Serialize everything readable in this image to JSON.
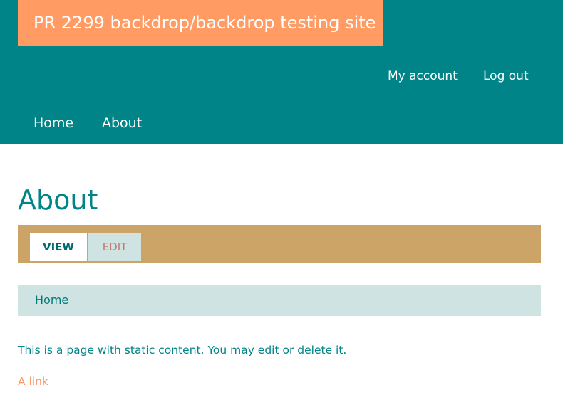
{
  "header": {
    "site_name": "PR 2299 backdrop/backdrop testing site",
    "account_menu": [
      "My account",
      "Log out"
    ],
    "main_menu": [
      "Home",
      "About"
    ]
  },
  "page": {
    "title": "About",
    "tabs": [
      {
        "label": "VIEW",
        "active": true
      },
      {
        "label": "EDIT",
        "active": false
      }
    ],
    "breadcrumb": [
      "Home"
    ],
    "body_text": "This is a page with static content. You may edit or delete it.",
    "link_text": "A link"
  },
  "colors": {
    "header_bg": "#008487",
    "site_name_bg": "#ff9b63",
    "tabs_bar_bg": "#cda467",
    "breadcrumb_bg": "#cfe3e2",
    "text_teal": "#008487",
    "link_orange": "#f59a6a"
  }
}
